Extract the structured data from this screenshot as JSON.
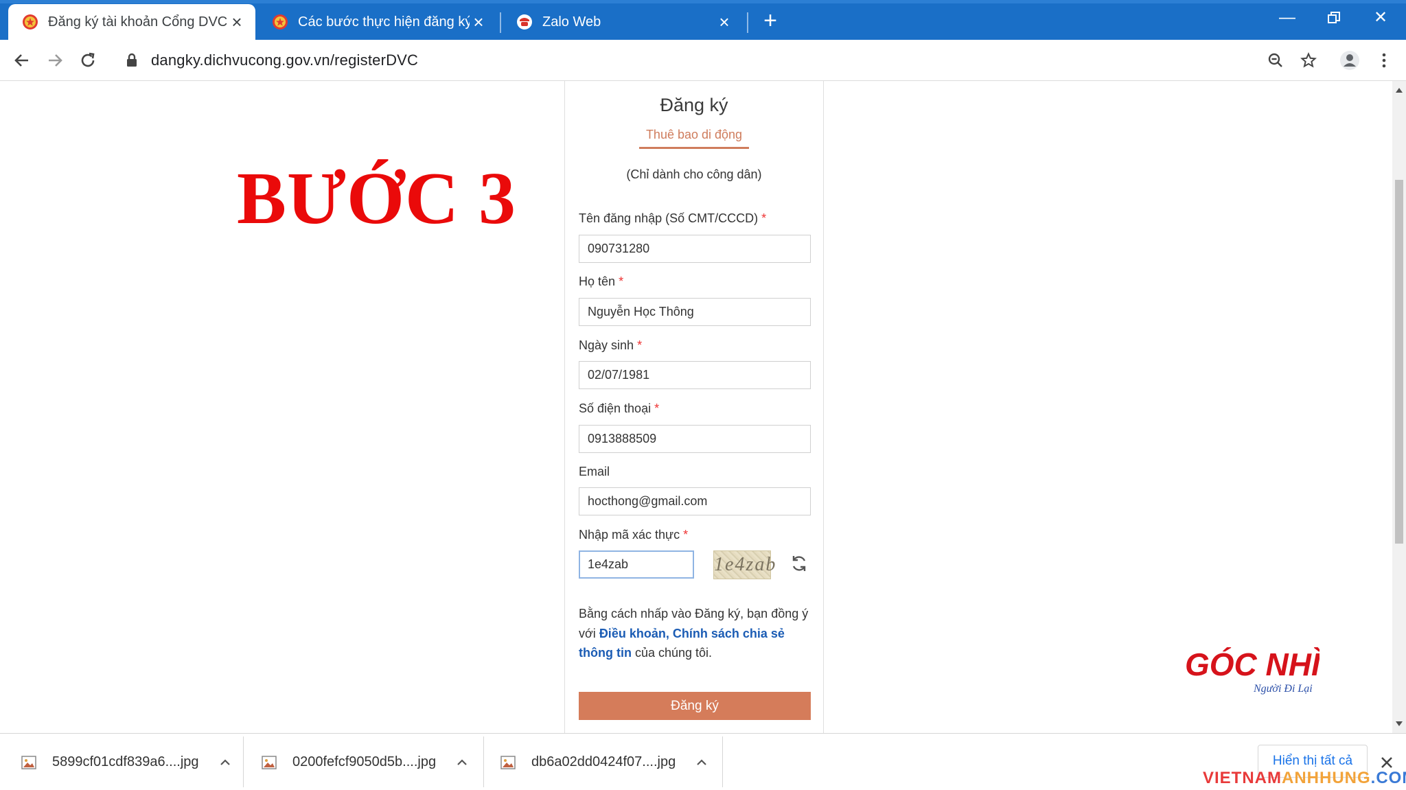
{
  "browser": {
    "tabs": [
      {
        "title": "Đăng ký tài khoản Cổng DVC quốc gia",
        "active": true
      },
      {
        "title": "Các bước thực hiện đăng ký tài khoản",
        "active": false
      },
      {
        "title": "Zalo Web",
        "active": false
      }
    ],
    "url": "dangky.dichvucong.gov.vn/registerDVC",
    "colors": {
      "tabstrip": "#1a6fc7"
    }
  },
  "overlay": {
    "step_heading": "BƯỚC 3",
    "logo": {
      "line1": "GÓC NHÌN",
      "line2": "Người Đi Lại"
    },
    "watermark": {
      "part1": "VIETNAM",
      "part2": "ANHHUNG",
      "part3": ".COM"
    }
  },
  "form": {
    "title": "Đăng ký",
    "tab_label": "Thuê bao di động",
    "note": "(Chỉ dành cho công dân)",
    "fields": {
      "username": {
        "label": "Tên đăng nhập (Số CMT/CCCD)",
        "value": "090731280"
      },
      "fullname": {
        "label": "Họ tên",
        "value": "Nguyễn Học Thông"
      },
      "dob": {
        "label": "Ngày sinh",
        "value": "02/07/1981"
      },
      "phone": {
        "label": "Số điện thoại",
        "value": "0913888509"
      },
      "email": {
        "label": "Email",
        "value": "hocthong@gmail.com"
      },
      "captcha": {
        "label": "Nhập mã xác thực",
        "value": "1e4zab",
        "image_text": "1e4zab"
      }
    },
    "required_mark": "*",
    "terms": {
      "prefix": "Bằng cách nhấp vào Đăng ký, bạn đồng ý với ",
      "link": "Điều khoản, Chính sách chia sẻ thông tin",
      "suffix": " của chúng tôi."
    },
    "submit_label": "Đăng ký",
    "accent_color": "#d57c5a"
  },
  "downloads": {
    "items": [
      {
        "name": "5899cf01cdf839a6....jpg"
      },
      {
        "name": "0200fefcf9050d5b....jpg"
      },
      {
        "name": "db6a02dd0424f07....jpg"
      }
    ],
    "show_all_label": "Hiển thị tất cả"
  }
}
